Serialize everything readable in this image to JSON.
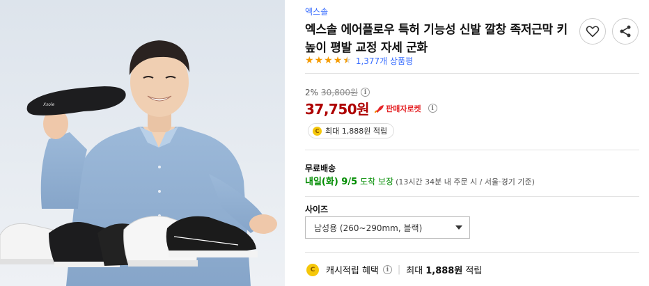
{
  "brand": "엑스솔",
  "title": "엑스솔 에어플로우 특허 기능성 신발 깔창 족저근막 키높이 평발 교정 자세 군화",
  "rating": {
    "value": 4.5,
    "reviews": "1,377개 상품평"
  },
  "icons": {
    "heart": "heart-icon",
    "share": "share-icon",
    "info": "info-icon",
    "rocket": "rocket-icon",
    "coin": "cash-coin-icon",
    "caret": "caret-down-icon"
  },
  "price": {
    "discount": "2%",
    "original": "30,800원",
    "sale": "37,750원",
    "badge": "판매자로켓"
  },
  "cashback": {
    "coin_letter": "C",
    "text": "최대 1,888원 적립"
  },
  "shipping": {
    "label": "무료배송",
    "date": "내일(화) 9/5",
    "guarantee": "도착 보장",
    "note": "(13시간 34분  내 주문 시 / 서울·경기 기준)"
  },
  "size": {
    "label": "사이즈",
    "selected": "남성용 (260~290mm, 블랙)"
  },
  "benefit": {
    "label": "캐시적립 혜택",
    "prefix": "최대",
    "amount": "1,888원",
    "suffix": "적립"
  },
  "colors": {
    "accent_blue": "#346aff",
    "price_red": "#ae0000",
    "rocket_red": "#e52528",
    "delivery_green": "#008c00",
    "star": "#f59b00"
  }
}
